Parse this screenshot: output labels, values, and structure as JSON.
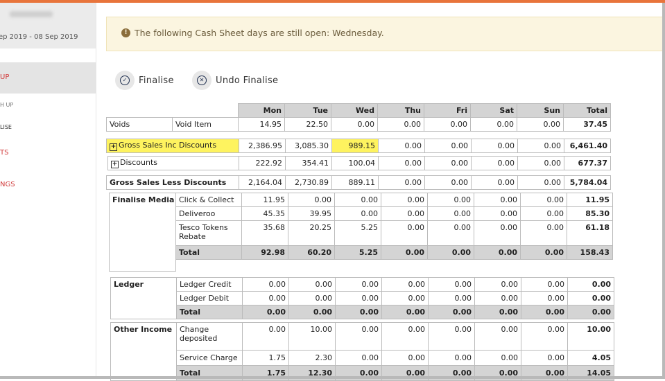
{
  "sidebar": {
    "date_range": "ep 2019 - 08 Sep 2019",
    "item_active": "UP",
    "item_2": "H UP",
    "item_3": "LISE",
    "item_4": "TS",
    "item_5": "NGS"
  },
  "alert": {
    "icon": "exclamation-icon",
    "text": "The following Cash Sheet days are still open: Wednesday."
  },
  "actions": {
    "finalise": "Finalise",
    "undo_finalise": "Undo Finalise"
  },
  "days": [
    "Mon",
    "Tue",
    "Wed",
    "Thu",
    "Fri",
    "Sat",
    "Sun",
    "Total"
  ],
  "voids": {
    "label": "Voids",
    "sub": "Void Item",
    "values": [
      "14.95",
      "22.50",
      "0.00",
      "0.00",
      "0.00",
      "0.00",
      "0.00",
      "37.45"
    ]
  },
  "gross_inc": {
    "label": "Gross Sales Inc Discounts",
    "values": [
      "2,386.95",
      "3,085.30",
      "989.15",
      "0.00",
      "0.00",
      "0.00",
      "0.00",
      "6,461.40"
    ]
  },
  "discounts": {
    "label": "Discounts",
    "values": [
      "222.92",
      "354.41",
      "100.04",
      "0.00",
      "0.00",
      "0.00",
      "0.00",
      "677.37"
    ]
  },
  "gross_less": {
    "label": "Gross Sales Less Discounts",
    "values": [
      "2,164.04",
      "2,730.89",
      "889.11",
      "0.00",
      "0.00",
      "0.00",
      "0.00",
      "5,784.04"
    ]
  },
  "finalise_media": {
    "label": "Finalise Media",
    "rows": [
      {
        "label": "Click & Collect",
        "values": [
          "11.95",
          "0.00",
          "0.00",
          "0.00",
          "0.00",
          "0.00",
          "0.00",
          "11.95"
        ]
      },
      {
        "label": "Deliveroo",
        "values": [
          "45.35",
          "39.95",
          "0.00",
          "0.00",
          "0.00",
          "0.00",
          "0.00",
          "85.30"
        ]
      },
      {
        "label": "Tesco Tokens Rebate",
        "values": [
          "35.68",
          "20.25",
          "5.25",
          "0.00",
          "0.00",
          "0.00",
          "0.00",
          "61.18"
        ]
      }
    ],
    "total": {
      "label": "Total",
      "values": [
        "92.98",
        "60.20",
        "5.25",
        "0.00",
        "0.00",
        "0.00",
        "0.00",
        "158.43"
      ]
    }
  },
  "ledger": {
    "label": "Ledger",
    "rows": [
      {
        "label": "Ledger Credit",
        "values": [
          "0.00",
          "0.00",
          "0.00",
          "0.00",
          "0.00",
          "0.00",
          "0.00",
          "0.00"
        ]
      },
      {
        "label": "Ledger Debit",
        "values": [
          "0.00",
          "0.00",
          "0.00",
          "0.00",
          "0.00",
          "0.00",
          "0.00",
          "0.00"
        ]
      }
    ],
    "total": {
      "label": "Total",
      "values": [
        "0.00",
        "0.00",
        "0.00",
        "0.00",
        "0.00",
        "0.00",
        "0.00",
        "0.00"
      ]
    }
  },
  "other_income": {
    "label": "Other Income",
    "rows": [
      {
        "label": "Change deposited",
        "values": [
          "0.00",
          "10.00",
          "0.00",
          "0.00",
          "0.00",
          "0.00",
          "0.00",
          "10.00"
        ]
      },
      {
        "label": "Service Charge",
        "values": [
          "1.75",
          "2.30",
          "0.00",
          "0.00",
          "0.00",
          "0.00",
          "0.00",
          "4.05"
        ]
      }
    ],
    "total": {
      "label": "Total",
      "values": [
        "1.75",
        "12.30",
        "0.00",
        "0.00",
        "0.00",
        "0.00",
        "0.00",
        "14.05"
      ]
    }
  }
}
